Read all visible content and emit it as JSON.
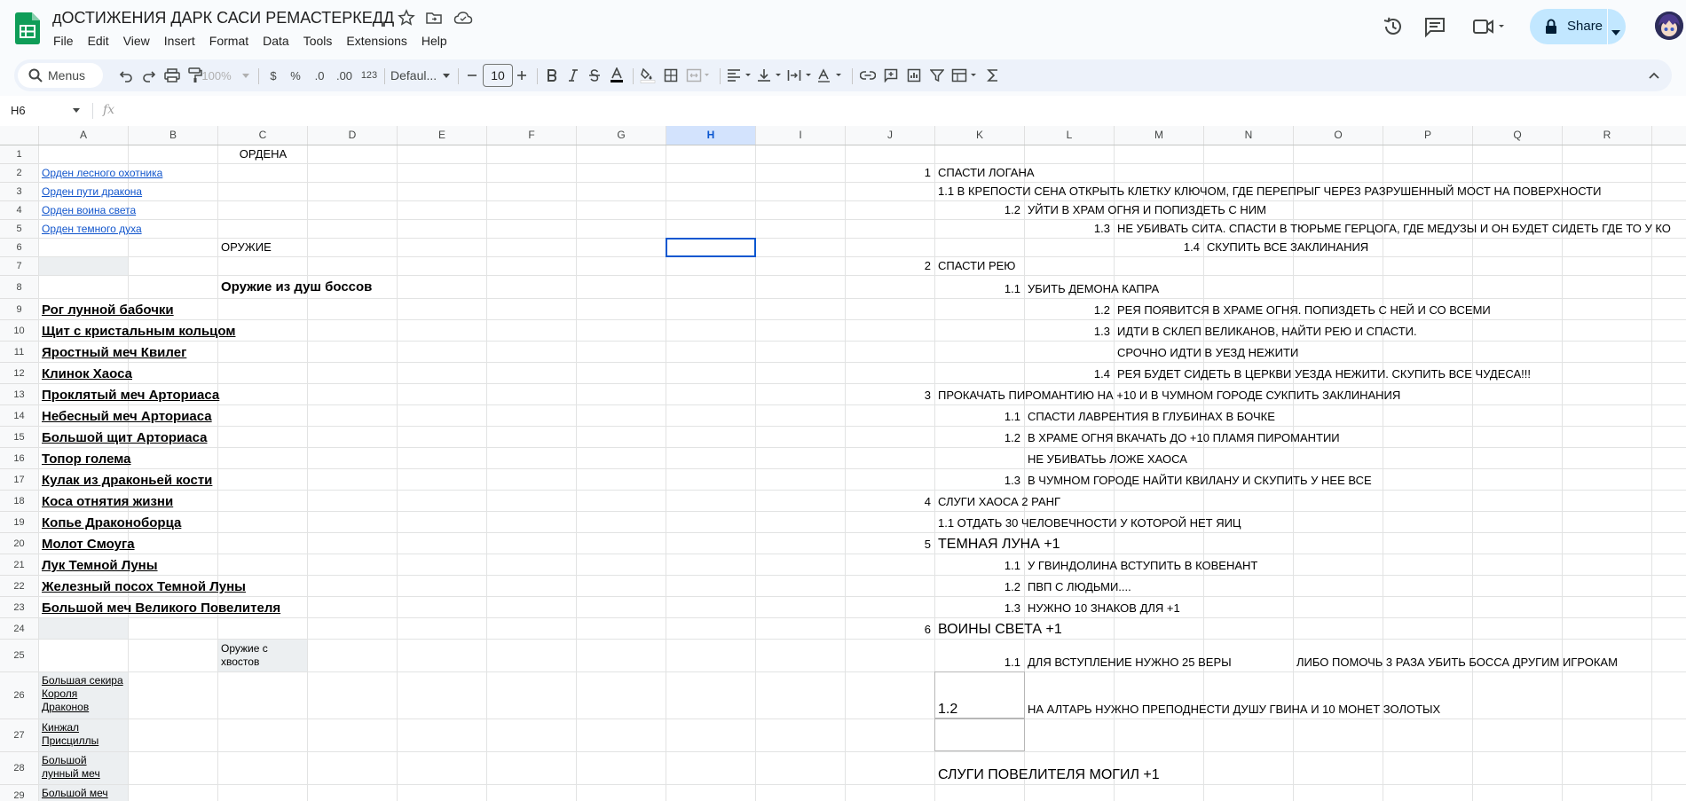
{
  "app": {
    "title": "дОСТИЖЕНИЯ ДАРК САСИ РЕМАСТЕРКЕДД",
    "menu": [
      "File",
      "Edit",
      "View",
      "Insert",
      "Format",
      "Data",
      "Tools",
      "Extensions",
      "Help"
    ],
    "share_label": "Share"
  },
  "toolbar": {
    "search_label": "Menus",
    "zoom": "100%",
    "currency": "$",
    "percent": "%",
    "dec_decrease": ".0",
    "dec_increase": ".00",
    "number_format": "123",
    "font": "Defaul...",
    "font_size": "10"
  },
  "formula_bar": {
    "name_box": "H6",
    "fx": "fx",
    "value": ""
  },
  "sheet": {
    "columns": [
      "A",
      "B",
      "C",
      "D",
      "E",
      "F",
      "G",
      "H",
      "I",
      "J",
      "K",
      "L",
      "M",
      "N",
      "O",
      "P",
      "Q",
      "R"
    ],
    "selected_column": "H",
    "selected_cell": "H6",
    "rows": [
      "1",
      "2",
      "3",
      "4",
      "5",
      "6",
      "7",
      "8",
      "9",
      "10",
      "11",
      "12",
      "13",
      "14",
      "15",
      "16",
      "17",
      "18",
      "19",
      "20",
      "21",
      "22",
      "23",
      "24",
      "25",
      "26",
      "27",
      "28",
      "29"
    ],
    "cells": {
      "C1": "ОРДЕНА",
      "A2": "Орден лесного охотника",
      "A3": "Орден пути дракона",
      "A4": "Орден воина света",
      "A5": "Орден темного духа",
      "C6": "ОРУЖИЕ",
      "C8": "Оружие из душ боссов",
      "A9": "Рог лунной бабочки",
      "A10": "Щит с кристальным кольцом",
      "A11": "Яростный меч Квилег",
      "A12": "Клинок Хаоса",
      "A13": "Проклятый меч Арториаса",
      "A14": "Небесный меч Арториаса",
      "A15": "Большой щит Арториаса",
      "A16": "Топор голема",
      "A17": "Кулак из драконьей кости",
      "A18": "Коса отнятия жизни",
      "A19": "Копье Драконоборца",
      "A20": "Молот Смоуга",
      "A21": "Лук Темной Луны",
      "A22": "Железный посох Темной Луны",
      "A23": "Большой меч Великого Повелителя",
      "C25": "Оружие с хвостов",
      "A26": "Большая секира Короля Драконов",
      "A27": "Кинжал Присциллы",
      "A28": "Большой лунный меч",
      "A29": "Большой меч",
      "J2": "1",
      "K2": "СПАСТИ ЛОГАНА",
      "K3": "1.1 В КРЕПОСТИ СЕНА ОТКРЫТЬ КЛЕТКУ КЛЮЧОМ, ГДЕ ПЕРЕПРЫГ ЧЕРЕЗ РАЗРУШЕННЫЙ МОСТ НА ПОВЕРХНОСТИ",
      "K4": "1.2",
      "L4": "УЙТИ В ХРАМ ОГНЯ И ПОПИЗДЕТЬ С НИМ",
      "L5": "1.3",
      "M5": "НЕ УБИВАТЬ СИТА. СПАСТИ В ТЮРЬМЕ ГЕРЦОГА, ГДЕ МЕДУЗЫ И ОН БУДЕТ СИДЕТЬ ГДЕ ТО У КО",
      "M6": "1.4",
      "N6": "СКУПИТЬ ВСЕ ЗАКЛИНАНИЯ",
      "J7": "2",
      "K7": "СПАСТИ РЕЮ",
      "K8": "1.1",
      "L8": "УБИТЬ ДЕМОНА КАПРА",
      "L9": "1.2",
      "M9": "РЕЯ ПОЯВИТСЯ В ХРАМЕ ОГНЯ. ПОПИЗДЕТЬ С НЕЙ И СО ВСЕМИ",
      "L10": "1.3",
      "M10": "ИДТИ В СКЛЕП ВЕЛИКАНОВ, НАЙТИ РЕЮ И СПАСТИ.",
      "M11": "СРОЧНО ИДТИ В УЕЗД НЕЖИТИ",
      "L12": "1.4",
      "M12": "РЕЯ БУДЕТ СИДЕТЬ В ЦЕРКВИ УЕЗДА НЕЖИТИ. СКУПИТЬ ВСЕ ЧУДЕСА!!!",
      "J13": "3",
      "K13": "ПРОКАЧАТЬ ПИРОМАНТИЮ НА +10 И В ЧУМНОМ ГОРОДЕ СУКПИТЬ ЗАКЛИНАНИЯ",
      "K14": "1.1",
      "L14": "СПАСТИ ЛАВРЕНТИЯ В ГЛУБИНАХ В БОЧКЕ",
      "K15": "1.2",
      "L15": "В ХРАМЕ ОГНЯ ВКАЧАТЬ ДО +10 ПЛАМЯ ПИРОМАНТИИ",
      "L16": "НЕ УБИВАТЬЬ ЛОЖЕ ХАОСА",
      "K17": "1.3",
      "L17": "В ЧУМНОМ ГОРОДЕ НАЙТИ КВИЛАНУ И СКУПИТЬ У НЕЕ ВСЕ",
      "J18": "4",
      "K18": "СЛУГИ ХАОСА 2 РАНГ",
      "K19": "1.1 ОТДАТЬ 30 ЧЕЛОВЕЧНОСТИ У КОТОРОЙ НЕТ ЯИЦ",
      "J20": "5",
      "K20": "ТЕМНАЯ ЛУНА +1",
      "K21": "1.1",
      "L21": "У ГВИНДОЛИНА ВСТУПИТЬ В КОВЕНАНТ",
      "K22": "1.2",
      "L22": "ПВП С ЛЮДЬМИ....",
      "K23": "1.3",
      "L23": "НУЖНО 10 ЗНАКОВ ДЛЯ +1",
      "J24": "6",
      "K24": "ВОИНЫ СВЕТА +1",
      "K25": "1.1",
      "L25": "ДЛЯ ВСТУПЛЕНИЕ НУЖНО 25 ВЕРЫ",
      "O25": "ЛИБО ПОМОЧЬ 3 РАЗА УБИТЬ БОССА ДРУГИМ ИГРОКАМ",
      "K26": "1.2",
      "L26": "НА АЛТАРЬ НУЖНО ПРЕПОДНЕСТИ ДУШУ ГВИНА И 10 МОНЕТ ЗОЛОТЫХ",
      "K28": "СЛУГИ ПОВЕЛИТЕЛЯ МОГИЛ +1"
    }
  },
  "colors": {
    "accent": "#0b57d0",
    "share_bg": "#c2e7ff",
    "link": "#1155cc",
    "sheets_green": "#0f9d58"
  }
}
